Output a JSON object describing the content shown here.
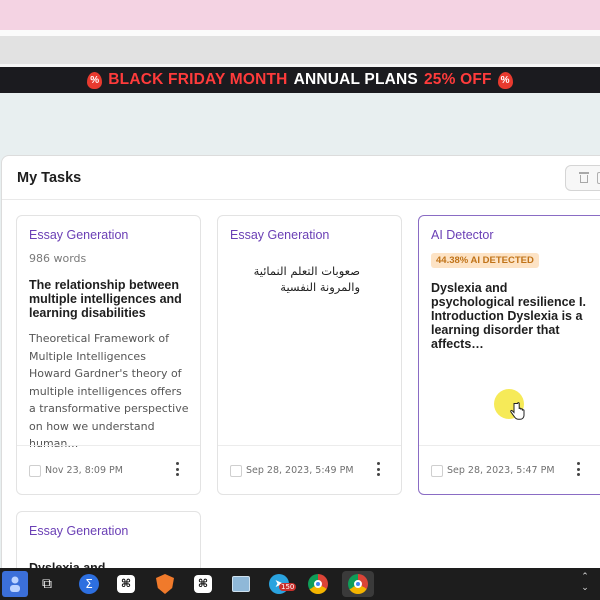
{
  "promo_banner": {
    "part1": "BLACK FRIDAY MONTH",
    "part2": "ANNUAL PLANS",
    "part3": "25% OFF",
    "icon": "percent-tag-icon"
  },
  "tasks_panel": {
    "title": "My Tasks"
  },
  "cards": [
    {
      "type": "Essay Generation",
      "words": "986 words",
      "title": "The relationship between multiple intelligences and learning disabilities",
      "body": "Theoretical Framework of Multiple Intelligences Howard Gardner's theory of multiple intelligences offers a transformative perspective on how we understand human…",
      "date": "Nov 23, 8:09 PM"
    },
    {
      "type": "Essay Generation",
      "title": "صعوبات التعلم النمائية والمرونة النفسية",
      "date": "Sep 28, 2023, 5:49 PM"
    },
    {
      "type": "AI Detector",
      "badge": "44.38% AI DETECTED",
      "title": "Dyslexia and psychological resilience I. Introduction Dyslexia is a learning disorder that affects…",
      "date": "Sep 28, 2023, 5:47 PM"
    },
    {
      "type": "Essay Generation",
      "title": "Dyslexia and psychological"
    }
  ],
  "taskbar": {
    "items": [
      "start-icon",
      "task-view-icon",
      "sigma-app-icon",
      "capcut-icon",
      "brave-browser-icon",
      "capcut-icon",
      "photos-icon",
      "telegram-icon",
      "chrome-icon",
      "chrome-icon"
    ],
    "telegram_badge": "150"
  }
}
